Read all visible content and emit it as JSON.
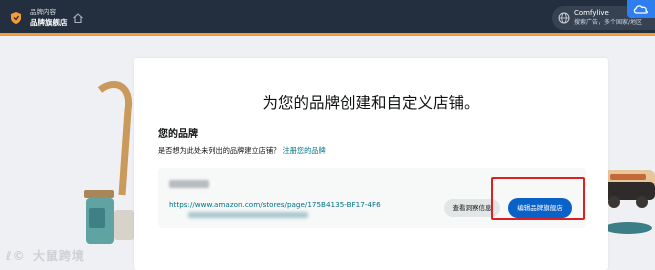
{
  "header": {
    "breadcrumb_parent": "品牌内容",
    "breadcrumb_current": "品牌旗舰店",
    "account_name": "Comfylive",
    "account_desc": "搜索广告，多个国家/地区"
  },
  "main": {
    "title": "为您的品牌创建和自定义店铺。",
    "section_title": "您的品牌",
    "prompt_text": "是否想为此处未列出的品牌建立店铺？",
    "register_link": "注册您的品牌",
    "store": {
      "url": "https://www.amazon.com/stores/page/175B4135-BF17-4F6",
      "view_button": "查看洞察信息",
      "edit_button": "编辑品牌旗舰店"
    }
  },
  "watermark": {
    "logo": "ℓ©",
    "text": "大鼠跨境"
  },
  "colors": {
    "header_bg": "#232f3e",
    "header_accent": "#f79b34",
    "primary_button": "#0a62c9",
    "link": "#007185",
    "highlight": "#e02020"
  }
}
